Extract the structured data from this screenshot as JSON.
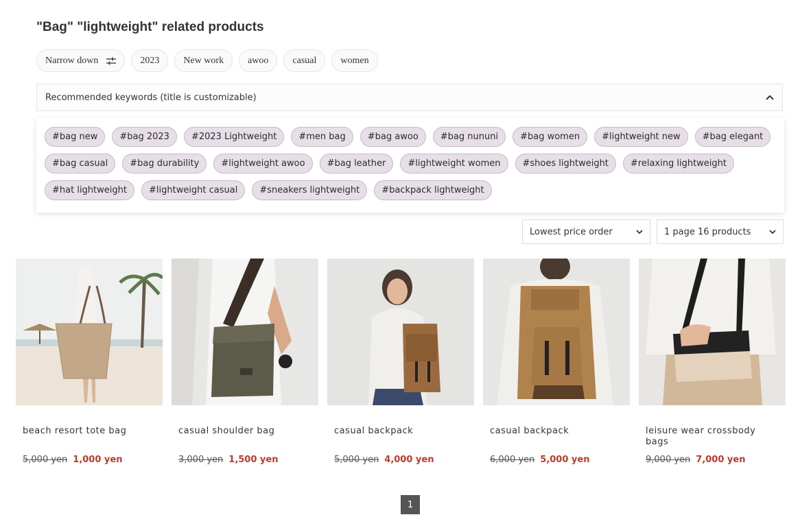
{
  "page": {
    "title": "\"Bag\" \"lightweight\" related products"
  },
  "filters": {
    "narrow_label": "Narrow down",
    "chips": [
      "2023",
      "New work",
      "awoo",
      "casual",
      "women"
    ]
  },
  "keywords": {
    "header": "Recommended keywords (title is customizable)",
    "tags": [
      "#bag new",
      "#bag 2023",
      "#2023 Lightweight",
      "#men bag",
      "#bag awoo",
      "#bag nununi",
      "#bag women",
      "#lightweight new",
      "#bag elegant",
      "#bag casual",
      "#bag durability",
      "#lightweight awoo",
      "#bag leather",
      "#lightweight women",
      "#shoes lightweight",
      "#relaxing lightweight",
      "#hat lightweight",
      "#lightweight casual",
      "#sneakers lightweight",
      "#backpack lightweight"
    ]
  },
  "sort": {
    "order": "Lowest price order",
    "per_page": "1 page 16 products"
  },
  "products": [
    {
      "name": "beach resort tote bag",
      "old_price": "5,000 yen",
      "price": "1,000 yen",
      "image_icon": "beach-tote-photo"
    },
    {
      "name": "casual shoulder bag",
      "old_price": "3,000 yen",
      "price": "1,500 yen",
      "image_icon": "shoulder-bag-photo"
    },
    {
      "name": "casual backpack",
      "old_price": "5,000 yen",
      "price": "4,000 yen",
      "image_icon": "woman-backpack-photo"
    },
    {
      "name": "casual backpack",
      "old_price": "6,000 yen",
      "price": "5,000 yen",
      "image_icon": "man-backpack-photo"
    },
    {
      "name": "leisure wear crossbody bags",
      "old_price": "9,000 yen",
      "price": "7,000 yen",
      "image_icon": "crossbody-bag-photo"
    }
  ],
  "pagination": {
    "current": "1"
  },
  "colors": {
    "tag_bg": "#e7dfe8",
    "sale_price": "#c0392b",
    "pager_bg": "#555555"
  }
}
